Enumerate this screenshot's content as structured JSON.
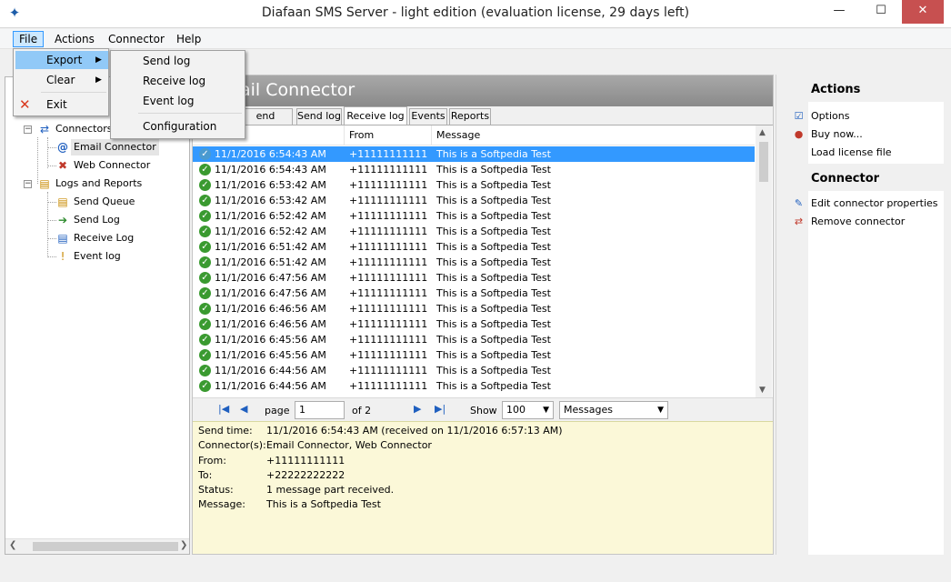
{
  "window": {
    "title": "Diafaan SMS Server - light edition (evaluation license, 29 days left)",
    "min_glyph": "—",
    "max_glyph": "☐",
    "close_glyph": "✕"
  },
  "menu": {
    "items": [
      "File",
      "Actions",
      "Connector",
      "Help"
    ]
  },
  "file_menu": {
    "export": "Export",
    "clear": "Clear",
    "exit": "Exit"
  },
  "export_submenu": {
    "items": [
      "Send log",
      "Receive log",
      "Event log",
      "Configuration"
    ]
  },
  "tree": {
    "connectors": "Connectors",
    "email_connector": "Email Connector",
    "web_connector": "Web Connector",
    "logs_reports": "Logs and Reports",
    "send_queue": "Send Queue",
    "send_log": "Send Log",
    "receive_log": "Receive Log",
    "event_log": "Event log"
  },
  "banner": {
    "title": "ail Connector"
  },
  "tabs": [
    "end queue",
    "Send log",
    "Receive log",
    "Events",
    "Reports"
  ],
  "grid": {
    "headers": [
      "",
      "From",
      "Message"
    ],
    "rows": [
      {
        "time": "11/1/2016 6:54:43 AM",
        "from": "+11111111111",
        "msg": "This is a Softpedia Test"
      },
      {
        "time": "11/1/2016 6:54:43 AM",
        "from": "+11111111111",
        "msg": "This is a Softpedia Test"
      },
      {
        "time": "11/1/2016 6:53:42 AM",
        "from": "+11111111111",
        "msg": "This is a Softpedia Test"
      },
      {
        "time": "11/1/2016 6:53:42 AM",
        "from": "+11111111111",
        "msg": "This is a Softpedia Test"
      },
      {
        "time": "11/1/2016 6:52:42 AM",
        "from": "+11111111111",
        "msg": "This is a Softpedia Test"
      },
      {
        "time": "11/1/2016 6:52:42 AM",
        "from": "+11111111111",
        "msg": "This is a Softpedia Test"
      },
      {
        "time": "11/1/2016 6:51:42 AM",
        "from": "+11111111111",
        "msg": "This is a Softpedia Test"
      },
      {
        "time": "11/1/2016 6:51:42 AM",
        "from": "+11111111111",
        "msg": "This is a Softpedia Test"
      },
      {
        "time": "11/1/2016 6:47:56 AM",
        "from": "+11111111111",
        "msg": "This is a Softpedia Test"
      },
      {
        "time": "11/1/2016 6:47:56 AM",
        "from": "+11111111111",
        "msg": "This is a Softpedia Test"
      },
      {
        "time": "11/1/2016 6:46:56 AM",
        "from": "+11111111111",
        "msg": "This is a Softpedia Test"
      },
      {
        "time": "11/1/2016 6:46:56 AM",
        "from": "+11111111111",
        "msg": "This is a Softpedia Test"
      },
      {
        "time": "11/1/2016 6:45:56 AM",
        "from": "+11111111111",
        "msg": "This is a Softpedia Test"
      },
      {
        "time": "11/1/2016 6:45:56 AM",
        "from": "+11111111111",
        "msg": "This is a Softpedia Test"
      },
      {
        "time": "11/1/2016 6:44:56 AM",
        "from": "+11111111111",
        "msg": "This is a Softpedia Test"
      },
      {
        "time": "11/1/2016 6:44:56 AM",
        "from": "+11111111111",
        "msg": "This is a Softpedia Test"
      }
    ]
  },
  "pager": {
    "page_label": "page",
    "page_value": "1",
    "of_label": "of 2",
    "show_label": "Show",
    "show_value": "100",
    "type_value": "Messages"
  },
  "details": {
    "send_time_label": "Send time:",
    "send_time_value": "11/1/2016 6:54:43 AM (received on 11/1/2016 6:57:13 AM)",
    "connectors_label": "Connector(s):",
    "connectors_value": "Email Connector, Web Connector",
    "from_label": "From:",
    "from_value": "+11111111111",
    "to_label": "To:",
    "to_value": "+22222222222",
    "status_label": "Status:",
    "status_value": "1 message part received.",
    "message_label": "Message:",
    "message_value": "This is a Softpedia Test"
  },
  "right_panel": {
    "actions_title": "Actions",
    "options": "Options",
    "buy_now": "Buy now...",
    "load_license": "Load license file",
    "connector_title": "Connector",
    "edit_connector": "Edit connector properties",
    "remove_connector": "Remove connector"
  },
  "colors": {
    "selection": "#3399ff",
    "details_bg": "#fbf8d8",
    "menu_highlight": "#91c9f7",
    "ok_green": "#3a9a30"
  }
}
